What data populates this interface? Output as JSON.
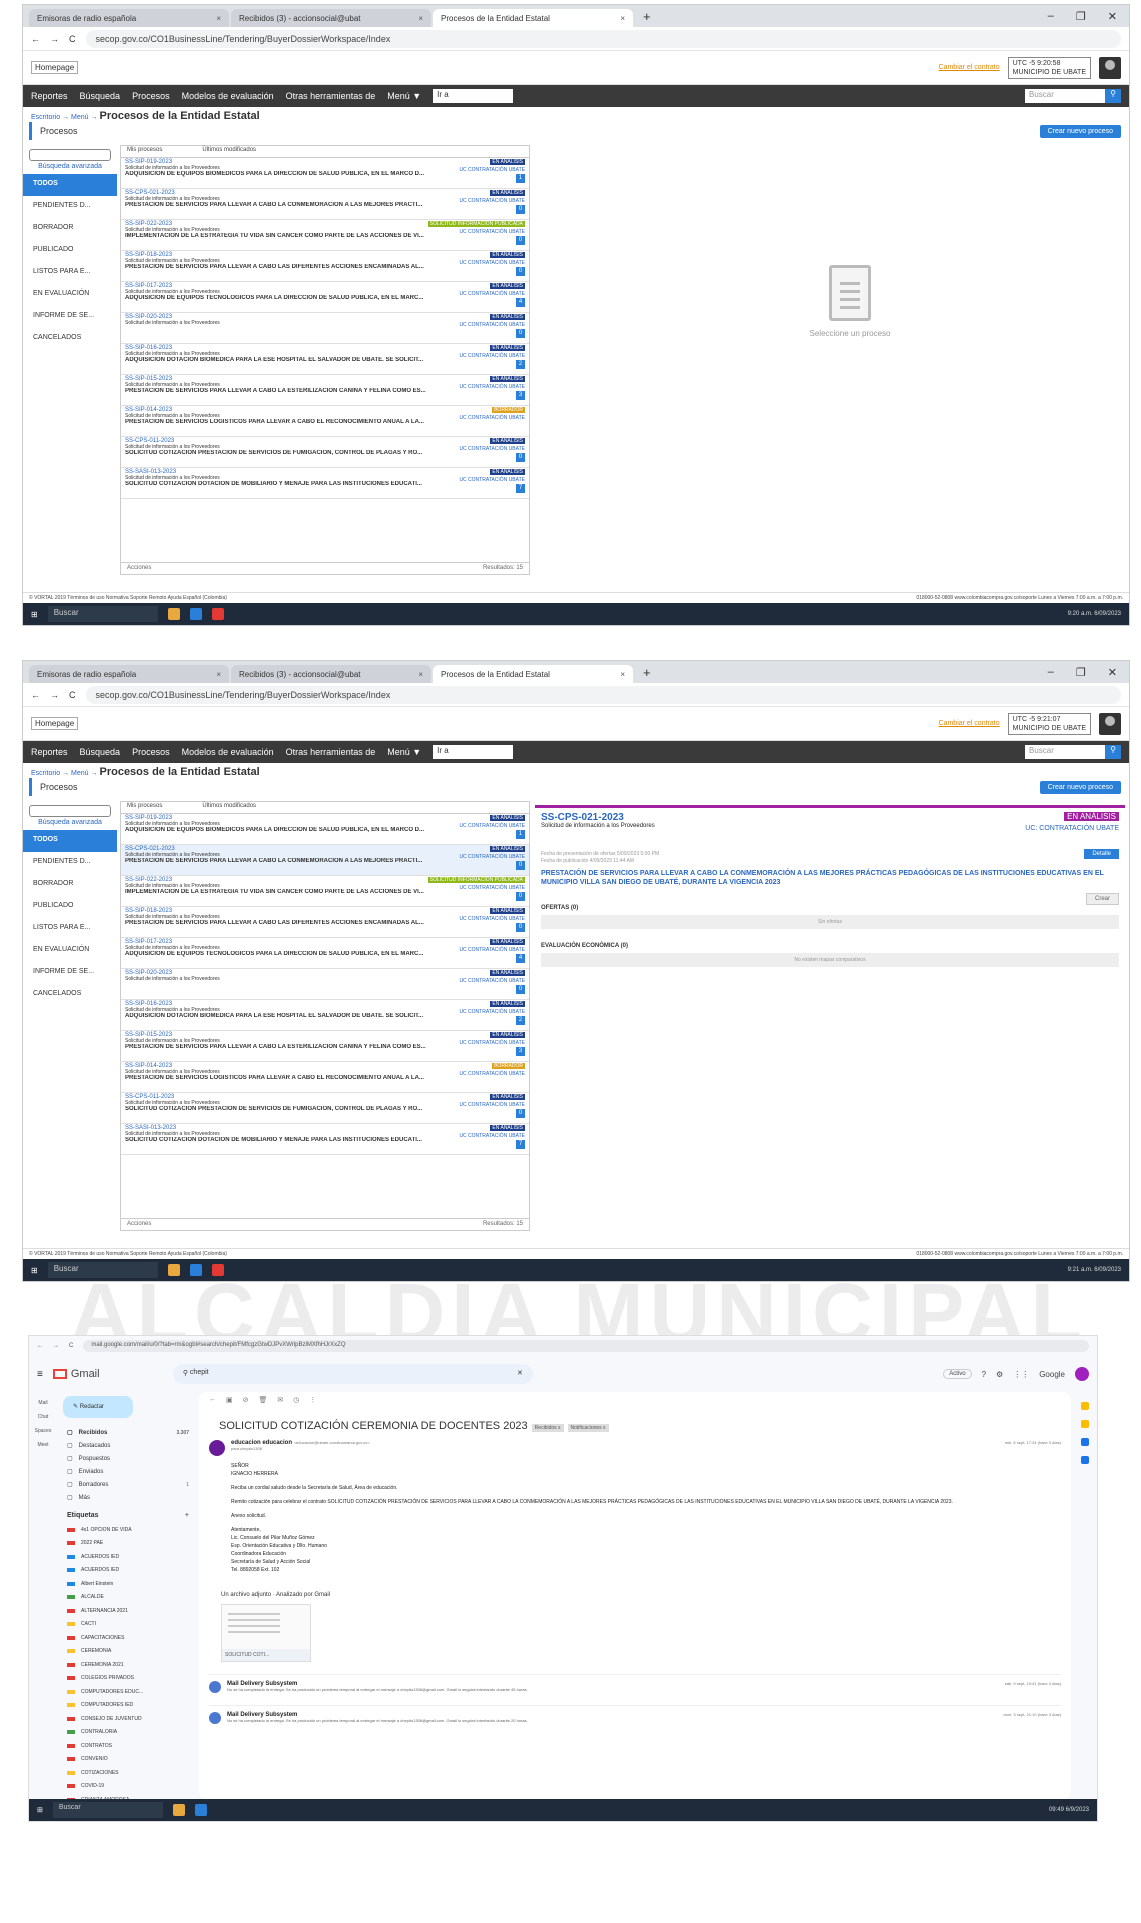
{
  "watermark": {
    "line1": "ALCALDÍA MUNICIPAL"
  },
  "browser": {
    "tabs": [
      "Emisoras de radio española",
      "Recibidos (3) - accionsocial@ubat",
      "Procesos de la Entidad Estatal"
    ],
    "url": "secop.gov.co/CO1BusinessLine/Tendering/BuyerDossierWorkspace/Index"
  },
  "app": {
    "logo": "Homepage",
    "cambiar": "Cambiar el contrato",
    "utc1": "UTC -5 9:20:58",
    "utc2": "UTC -5 9:21:07",
    "entity": "MUNICIPIO DE UBATE",
    "nav": [
      "Reportes",
      "Búsqueda",
      "Procesos",
      "Modelos de evaluación",
      "Otras herramientas de",
      "Menú ▼"
    ],
    "nav_select": "Ir a",
    "search_placeholder": "Buscar",
    "crumb": "Escritorio → Menú →",
    "page_title": "Procesos de la Entidad Estatal",
    "section": "Procesos",
    "crear": "Crear nuevo proceso"
  },
  "sidebar": {
    "advanced": "Búsqueda avanzada",
    "items": [
      "TODOS",
      "PENDIENTES D...",
      "BORRADOR",
      "PUBLICADO",
      "LISTOS PARA E...",
      "EN EVALUACIÓN",
      "INFORME DE SE...",
      "CANCELADOS"
    ]
  },
  "list": {
    "head1": "Mis procesos",
    "head2": "Últimos modificados",
    "acciones": "Acciones",
    "resultados": "Resultados: 15",
    "items": [
      {
        "code": "SS-SIP-019-2023",
        "type": "Solicitud de información a los Proveedores",
        "title": "ADQUISICIÓN DE EQUIPOS BIOMEDICOS PARA LA DIRECCION DE SALUD PUBLICA, EN EL MARCO D...",
        "badge": "EN ANÁLISIS",
        "n": "1"
      },
      {
        "code": "SS-CPS-021-2023",
        "type": "Solicitud de información a los Proveedores",
        "title": "PRESTACIÓN DE SERVICIOS PARA LLEVAR A CABO LA CONMEMORACION A LAS MEJORES PRACTI...",
        "badge": "EN ANÁLISIS",
        "n": "0"
      },
      {
        "code": "SS-SIP-022-2023",
        "type": "Solicitud de información a los Proveedores",
        "title": "IMPLEMENTACIÓN DE LA ESTRATEGIA TU VIDA SIN CANCER COMO PARTE DE LAS ACCIONES DE VI...",
        "badge": "SOLICITUD INFORMACIÓN PUBLICADA",
        "n": "0"
      },
      {
        "code": "SS-SIP-018-2023",
        "type": "Solicitud de información a los Proveedores",
        "title": "PRESTACION DE SERVICIOS PARA LLEVAR A CABO LAS DIFERENTES ACCIONES ENCAMINADAS AL...",
        "badge": "EN ANÁLISIS",
        "n": "0"
      },
      {
        "code": "SS-SIP-017-2023",
        "type": "Solicitud de información a los Proveedores",
        "title": "ADQUISICIÓN DE EQUIPOS TECNOLOGICOS PARA LA DIRECCIÓN DE SALUD PUBLICA, EN EL MARC...",
        "badge": "EN ANÁLISIS",
        "n": "4"
      },
      {
        "code": "SS-SIP-020-2023",
        "type": "Solicitud de información a los Proveedores",
        "title": "",
        "badge": "EN ANÁLISIS",
        "n": "0"
      },
      {
        "code": "SS-SIP-016-2023",
        "type": "Solicitud de información a los Proveedores",
        "title": "ADQUISICIÓN DOTACIÓN BIOMEDICA PARA LA ESE HOSPITAL EL SALVADOR DE UBATE. SE SOLICIT...",
        "badge": "EN ANÁLISIS",
        "n": "2"
      },
      {
        "code": "SS-SIP-015-2023",
        "type": "Solicitud de información a los Proveedores",
        "title": "PRESTACION DE SERVICIOS PARA LLEVAR A CABO LA ESTERILIZACION CANINA Y FELINA COMO ES...",
        "badge": "EN ANÁLISIS",
        "n": "3"
      },
      {
        "code": "SS-SIP-014-2023",
        "type": "Solicitud de información a los Proveedores",
        "title": "PRESTACION DE SERVICIOS LOGISTICOS PARA LLEVAR A CABO EL RECONOCIMIENTO ANUAL A LA...",
        "badge": "BORRADOR",
        "n": ""
      },
      {
        "code": "SS-CPS-011-2023",
        "type": "Solicitud de información a los Proveedores",
        "title": "SOLICITUD COTIZACIÓN PRESTACION DE SERVICIOS DE FUMIGACION, CONTROL DE PLAGAS Y RO...",
        "badge": "EN ANÁLISIS",
        "n": "0"
      },
      {
        "code": "SS-SASI-013-2023",
        "type": "Solicitud de información a los Proveedores",
        "title": "SOLICITUD COTIZACIÓN DOTACION DE MOBILIARIO Y MENAJE PARA LAS INSTITUCIONES EDUCATI...",
        "badge": "EN ANÁLISIS",
        "n": "7"
      }
    ],
    "uc": "UC CONTRATACIÓN UBATE"
  },
  "empty": "Seleccione un proceso",
  "detail": {
    "code": "SS-CPS-021-2023",
    "type": "Solicitud de información a los Proveedores",
    "badge": "EN ANÁLISIS",
    "uc": "UC: CONTRATACIÓN UBATE",
    "meta1": "Fecha de presentación de ofertas 5/09/2023 5:00 PM",
    "meta2": "Fecha de publicación 4/09/2023 11:44 AM",
    "title": "PRESTACIÓN DE SERVICIOS PARA LLEVAR A CABO LA CONMEMORACIÓN A LAS MEJORES PRÁCTICAS PEDAGÓGICAS DE LAS INSTITUCIONES EDUCATIVAS EN EL MUNICIPIO VILLA SAN DIEGO DE UBATÉ, DURANTE LA VIGENCIA 2023",
    "detalle": "Detalle",
    "crear": "Crear",
    "ofertas": "OFERTAS (0)",
    "sin": "Sin ofertas",
    "eval": "EVALUACIÓN ECONÓMICA (0)",
    "noexist": "No existen mapas comparativos"
  },
  "footer": {
    "left": "© VORTAL 2019  Términos de uso  Normativa  Soporte Remoto  Ayuda  Español (Colombia)",
    "right": "018000-52-0808  www.colombiacompra.gov.co/soporte  Lunes a Viernes 7:00 a.m. a 7:00 p.m."
  },
  "taskbar": {
    "search": "Buscar",
    "time1": "9:20 a.m. 6/09/2023",
    "time2": "9:21 a.m. 6/09/2023",
    "time3": "09:49 6/9/2023"
  },
  "gmail": {
    "url": "mail.google.com/mail/u/0/?tab=rm&ogbl#search/chepit/FMfcgzGtwDJPvXWrlpBzlMXfhHJrXxZQ",
    "brand": "Gmail",
    "search": "chepit",
    "active": "Activo",
    "google": "Google",
    "compose": "Redactar",
    "folders": [
      {
        "n": "Recibidos",
        "c": "3.307"
      },
      {
        "n": "Destacados",
        "c": ""
      },
      {
        "n": "Pospuestos",
        "c": ""
      },
      {
        "n": "Enviados",
        "c": ""
      },
      {
        "n": "Borradores",
        "c": "1"
      },
      {
        "n": "Más",
        "c": ""
      }
    ],
    "labels_title": "Etiquetas",
    "labels": [
      "4x1 OPCION DE VIDA",
      "2022 PAE",
      "ACUERDOS IED",
      "ACUERDOS IED",
      "Albert Einstein",
      "ALCALDE",
      "ALTERNANCIA 2021",
      "CACTI",
      "CAPACITACIONES",
      "CEREMONIA",
      "CEREMONIA 2021",
      "COLEGIOS PRIVADOS",
      "COMPUTADORES EDUC...",
      "COMPUTADORES IED",
      "CONSEJO DE JUVENTUD",
      "CONTRALORIA",
      "CONTRATOS",
      "CONVENIO",
      "COTIZACIONES",
      "COVID-19",
      "CRIANZA AMOROSA"
    ],
    "label_colors": [
      "#e53935",
      "#e53935",
      "#1e88e5",
      "#1e88e5",
      "#1e88e5",
      "#43a047",
      "#e53935",
      "#fbc02d",
      "#e53935",
      "#fbc02d",
      "#e53935",
      "#e53935",
      "#fbc02d",
      "#fbc02d",
      "#e53935",
      "#43a047",
      "#e53935",
      "#e53935",
      "#fbc02d",
      "#e53935",
      "#e53935"
    ],
    "rail": [
      "Mail",
      "Chat",
      "Spaces",
      "Meet"
    ],
    "subject": "SOLICITUD COTIZACIÓN CEREMONIA DE DOCENTES 2023",
    "tag1": "Recibidos x",
    "tag2": "Notificaciones x",
    "sender": "educacion educacion",
    "sender_email": "<educacion@ubate-cundinamarca.gov.co>",
    "to": "para chepito1306",
    "date": "mié, 6 sept, 17:24 (hace 3 días)",
    "body": [
      "SEÑOR",
      "IGNACIO HERRERA",
      "Reciba un cordial saludo desde la Secretaría de Salud, Área de educación.",
      "Remito cotización para celebrar el contrato SOLICITUD COTIZACIÓN PRESTACIÓN DE SERVICIOS PARA LLEVAR A CABO LA CONMEMORACIÓN A LAS MEJORES PRÁCTICAS PEDAGÓGICAS DE LAS INSTITUCIONES EDUCATIVAS EN EL MUNICIPIO VILLA SAN DIEGO DE UBATÉ, DURANTE LA VIGENCIA 2023.",
      "Anexo solicitud.",
      "Atentamente,",
      "Lic. Consuelo del Pilar Muñoz Gómez",
      "Esp. Orientación Educativa y Dllo. Humano",
      "Coordinadora Educación",
      "Secretaría de Salud y Acción Social",
      "Tel. 8892058 Ext. 102"
    ],
    "attach": "Un archivo adjunto · Analizado por Gmail",
    "attach_name": "SOLICITUD COTI...",
    "msgs": [
      {
        "n": "Mail Delivery Subsystem",
        "p": "No se ha completado la entrega. Se ha producido un problema temporal al entregar el mensaje a chepito1306@gmail.com. Gmail lo seguirá intentando durante 45 horas.",
        "d": "sáb, 9 sept, 19:41 (hace 4 días)"
      },
      {
        "n": "Mail Delivery Subsystem",
        "p": "No se ha completado la entrega. Se ha producido un problema temporal al entregar el mensaje a chepito1306@gmail.com. Gmail lo seguirá intentando durante 20 horas.",
        "d": "dom, 3 sept, 21:10 (hace 3 días)"
      }
    ]
  }
}
